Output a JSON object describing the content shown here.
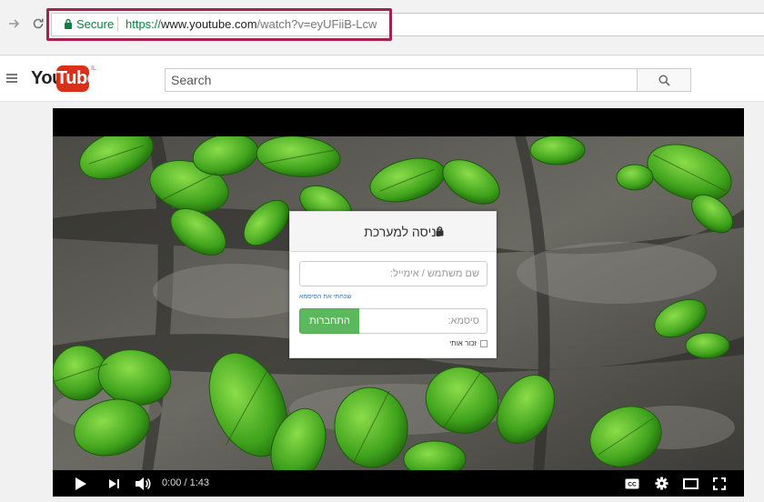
{
  "browser": {
    "nav_forward_icon": "arrow-right-icon",
    "reload_icon": "reload-icon",
    "secure_label": "Secure",
    "url_scheme": "https://",
    "url_host": "www.youtube.com",
    "url_path": "/watch?v=eyUFiiB-Lcw",
    "highlight_color": "#a7224a",
    "secure_color": "#0b8043"
  },
  "youtube": {
    "logo_you": "You",
    "logo_tube": "Tube",
    "logo_region": "IL",
    "search_placeholder": "Search",
    "brand_color": "#d7311c"
  },
  "player": {
    "time": "0:00 / 1:43",
    "controls": [
      "play-icon",
      "next-icon",
      "volume-icon",
      "captions-icon",
      "settings-icon",
      "theater-icon",
      "fullscreen-icon"
    ]
  },
  "login": {
    "title": "כניסה למערכת",
    "username_placeholder": "שם משתמש / אימייל:",
    "forgot_link": "שכחתי את הסיסמא",
    "password_placeholder": "סיסמא:",
    "submit_label": "התחברות",
    "remember_label": "זכור אותי",
    "submit_color": "#5cb85c"
  }
}
